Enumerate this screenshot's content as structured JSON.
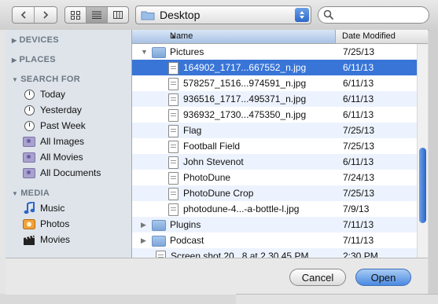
{
  "toolbar": {
    "location": "Desktop",
    "search_placeholder": ""
  },
  "sidebar": {
    "sections": {
      "devices": "DEVICES",
      "places": "PLACES",
      "search_for": "SEARCH FOR",
      "media": "MEDIA"
    },
    "search_items": [
      {
        "label": "Today",
        "icon": "clock-icon"
      },
      {
        "label": "Yesterday",
        "icon": "clock-icon"
      },
      {
        "label": "Past Week",
        "icon": "clock-icon"
      },
      {
        "label": "All Images",
        "icon": "smart-folder-icon"
      },
      {
        "label": "All Movies",
        "icon": "smart-folder-icon"
      },
      {
        "label": "All Documents",
        "icon": "smart-folder-icon"
      }
    ],
    "media_items": [
      {
        "label": "Music",
        "icon": "music-note-icon"
      },
      {
        "label": "Photos",
        "icon": "photos-icon"
      },
      {
        "label": "Movies",
        "icon": "clapboard-icon"
      }
    ]
  },
  "list": {
    "columns": {
      "name": "Name",
      "date": "Date Modified"
    },
    "rows": [
      {
        "name": "Pictures",
        "date": "7/25/13",
        "kind": "folder",
        "level": 0,
        "disclosure": "open"
      },
      {
        "name": "164902_1717...667552_n.jpg",
        "date": "6/11/13",
        "kind": "file",
        "level": 1,
        "selected": true
      },
      {
        "name": "578257_1516...974591_n.jpg",
        "date": "6/11/13",
        "kind": "file",
        "level": 1
      },
      {
        "name": "936516_1717...495371_n.jpg",
        "date": "6/11/13",
        "kind": "file",
        "level": 1
      },
      {
        "name": "936932_1730...475350_n.jpg",
        "date": "6/11/13",
        "kind": "file",
        "level": 1
      },
      {
        "name": "Flag",
        "date": "7/25/13",
        "kind": "file",
        "level": 1
      },
      {
        "name": "Football Field",
        "date": "7/25/13",
        "kind": "file",
        "level": 1
      },
      {
        "name": "John Stevenot",
        "date": "6/11/13",
        "kind": "file",
        "level": 1
      },
      {
        "name": "PhotoDune",
        "date": "7/24/13",
        "kind": "file",
        "level": 1
      },
      {
        "name": "PhotoDune Crop",
        "date": "7/25/13",
        "kind": "file",
        "level": 1
      },
      {
        "name": "photodune-4...-a-bottle-l.jpg",
        "date": "7/9/13",
        "kind": "file",
        "level": 1
      },
      {
        "name": "Plugins",
        "date": "7/11/13",
        "kind": "folder",
        "level": 0,
        "disclosure": "closed"
      },
      {
        "name": "Podcast",
        "date": "7/11/13",
        "kind": "folder",
        "level": 0,
        "disclosure": "closed"
      },
      {
        "name": "Screen shot 20...8 at 2.30.45 PM",
        "date": "2:30 PM",
        "kind": "file",
        "level": 0
      }
    ]
  },
  "buttons": {
    "cancel": "Cancel",
    "open": "Open"
  },
  "colors": {
    "selection": "#3875d7",
    "accent": "#2d68c9"
  }
}
